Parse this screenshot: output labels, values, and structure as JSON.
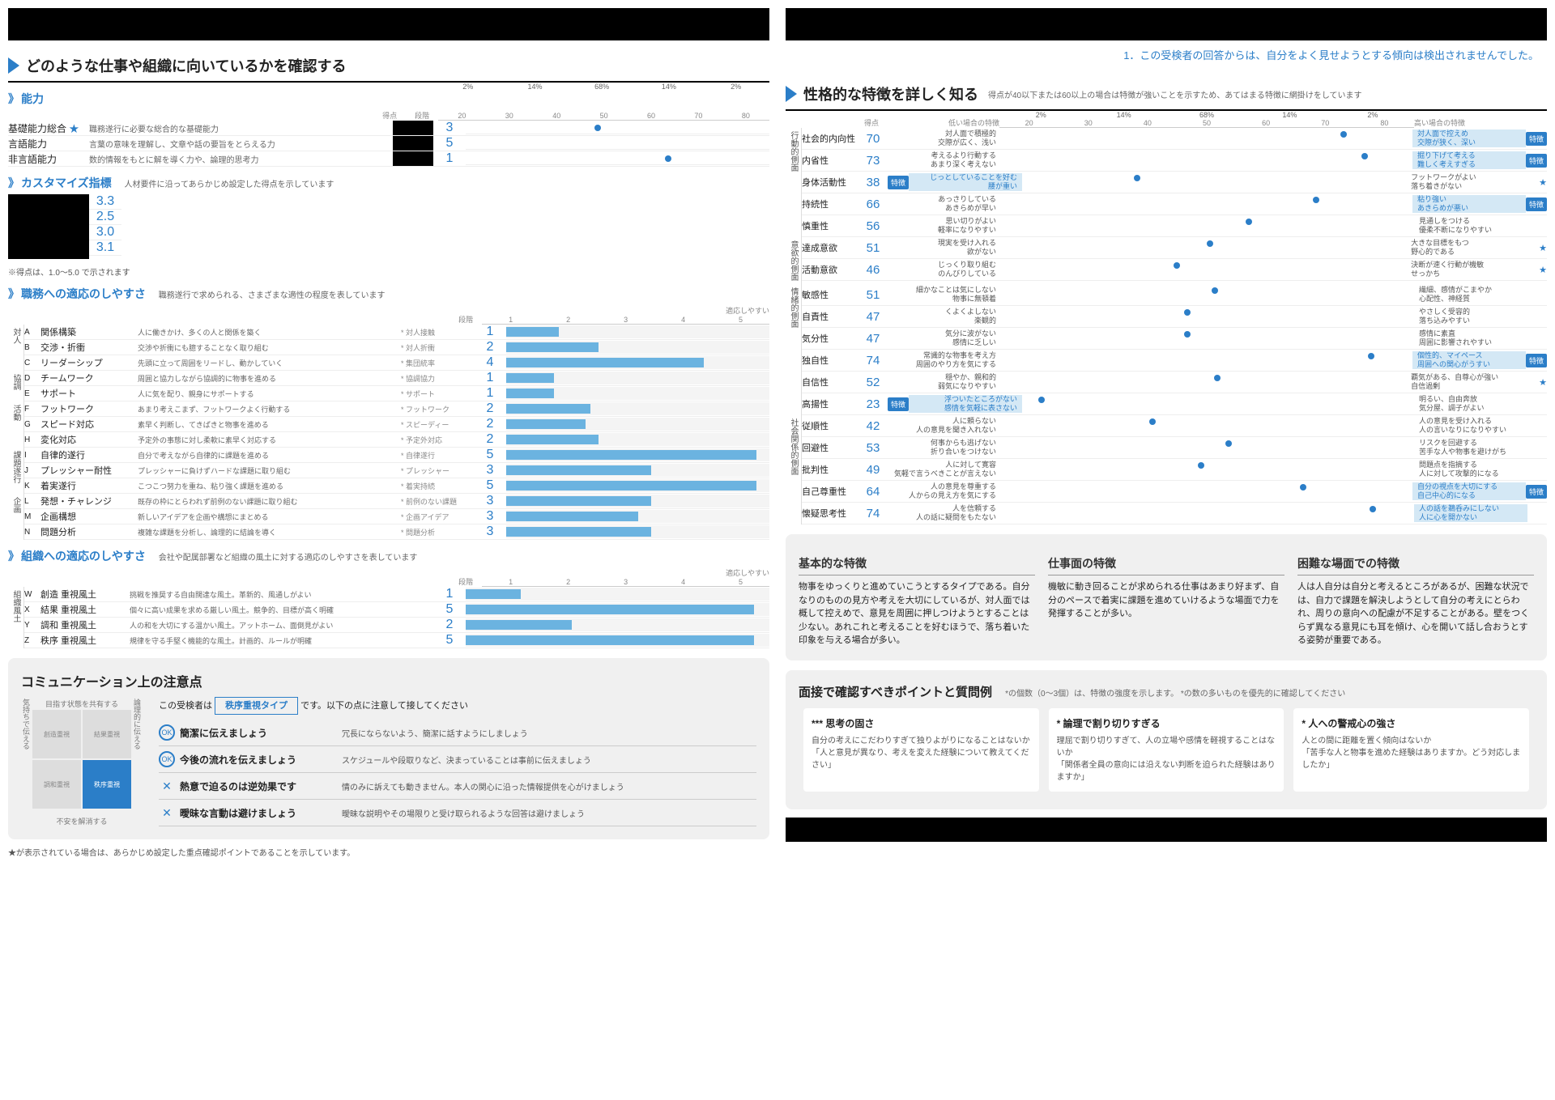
{
  "notice": "1．この受検者の回答からは、自分をよく見せようとする傾向は検出されませんでした。",
  "left": {
    "title": "どのような仕事や組織に向いているかを確認する",
    "ability": {
      "header": "能力",
      "score_label": "得点",
      "stage_label": "段階",
      "dist": [
        "2%",
        "14%",
        "68%",
        "14%",
        "2%"
      ],
      "axis": [
        "20",
        "30",
        "40",
        "50",
        "60",
        "70",
        "80"
      ],
      "rows": [
        {
          "name": "基礎能力総合",
          "star": true,
          "desc": "職務遂行に必要な総合的な基礎能力",
          "stage": 3,
          "dot": 46
        },
        {
          "name": "言語能力",
          "desc": "言葉の意味を理解し、文章や話の要旨をとらえる力",
          "stage": 5,
          "dot": null
        },
        {
          "name": "非言語能力",
          "desc": "数的情報をもとに解を導く力や、論理的思考力",
          "stage": 1,
          "dot": 60
        }
      ]
    },
    "customize": {
      "header": "カスタマイズ指標",
      "note": "人材要件に沿ってあらかじめ設定した得点を示しています",
      "scores": [
        "3.3",
        "2.5",
        "3.0",
        "3.1"
      ],
      "footnote": "※得点は、1.0～5.0 で示されます"
    },
    "job_adapt": {
      "header": "職務への適応のしやすさ",
      "note": "職務遂行で求められる、さまざまな適性の程度を表しています",
      "stage_label": "段階",
      "legend": "適応しやすい",
      "axis": [
        "1",
        "2",
        "3",
        "4",
        "5"
      ],
      "groups": [
        {
          "label": "対人",
          "rows": [
            {
              "code": "A",
              "name": "関係構築",
              "desc": "人に働きかけ、多くの人と関係を築く",
              "tag": "* 対人接触",
              "stage": 1,
              "bar": 20
            },
            {
              "code": "B",
              "name": "交渉・折衝",
              "desc": "交渉や折衝にも臆することなく取り組む",
              "tag": "* 対人折衝",
              "stage": 2,
              "bar": 35
            },
            {
              "code": "C",
              "name": "リーダーシップ",
              "desc": "先頭に立って周囲をリードし、動かしていく",
              "tag": "* 集団統率",
              "stage": 4,
              "bar": 75
            }
          ]
        },
        {
          "label": "協調",
          "rows": [
            {
              "code": "D",
              "name": "チームワーク",
              "desc": "周囲と協力しながら協調的に物事を進める",
              "tag": "* 協調協力",
              "stage": 1,
              "bar": 18
            },
            {
              "code": "E",
              "name": "サポート",
              "desc": "人に気を配り、親身にサポートする",
              "tag": "* サポート",
              "stage": 1,
              "bar": 18
            }
          ]
        },
        {
          "label": "活動",
          "rows": [
            {
              "code": "F",
              "name": "フットワーク",
              "desc": "あまり考えこまず、フットワークよく行動する",
              "tag": "* フットワーク",
              "stage": 2,
              "bar": 32
            },
            {
              "code": "G",
              "name": "スピード対応",
              "desc": "素早く判断し、てきぱきと物事を進める",
              "tag": "* スピーディー",
              "stage": 2,
              "bar": 30
            },
            {
              "code": "H",
              "name": "変化対応",
              "desc": "予定外の事態に対し柔軟に素早く対応する",
              "tag": "* 予定外対応",
              "stage": 2,
              "bar": 35
            }
          ]
        },
        {
          "label": "課題遂行",
          "rows": [
            {
              "code": "I",
              "name": "自律的遂行",
              "desc": "自分で考えながら自律的に課題を進める",
              "tag": "* 自律遂行",
              "stage": 5,
              "bar": 95
            },
            {
              "code": "J",
              "name": "プレッシャー耐性",
              "desc": "プレッシャーに負けずハードな課題に取り組む",
              "tag": "* プレッシャー",
              "stage": 3,
              "bar": 55
            },
            {
              "code": "K",
              "name": "着実遂行",
              "desc": "こつこつ努力を重ね、粘り強く課題を進める",
              "tag": "* 着実持続",
              "stage": 5,
              "bar": 95
            }
          ]
        },
        {
          "label": "企画",
          "rows": [
            {
              "code": "L",
              "name": "発想・チャレンジ",
              "desc": "既存の枠にとらわれず前例のない課題に取り組む",
              "tag": "* 前例のない課題",
              "stage": 3,
              "bar": 55
            },
            {
              "code": "M",
              "name": "企画構想",
              "desc": "新しいアイデアを企画や構想にまとめる",
              "tag": "* 企画アイデア",
              "stage": 3,
              "bar": 50
            },
            {
              "code": "N",
              "name": "問題分析",
              "desc": "複雑な課題を分析し、論理的に結論を導く",
              "tag": "* 問題分析",
              "stage": 3,
              "bar": 55
            }
          ]
        }
      ]
    },
    "org_adapt": {
      "header": "組織への適応のしやすさ",
      "note": "会社や配属部署など組織の風土に対する適応のしやすさを表しています",
      "stage_label": "段階",
      "legend": "適応しやすい",
      "axis": [
        "1",
        "2",
        "3",
        "4",
        "5"
      ],
      "group_label": "組織風土",
      "rows": [
        {
          "code": "W",
          "name": "創造 重視風土",
          "desc": "挑戦を推奨する自由闊達な風土。革新的、風通しがよい",
          "stage": 1,
          "bar": 18
        },
        {
          "code": "X",
          "name": "結果 重視風土",
          "desc": "個々に高い成果を求める厳しい風土。競争的、目標が高く明確",
          "stage": 5,
          "bar": 95
        },
        {
          "code": "Y",
          "name": "調和 重視風土",
          "desc": "人の和を大切にする温かい風土。アットホーム、面倒見がよい",
          "stage": 2,
          "bar": 35
        },
        {
          "code": "Z",
          "name": "秩序 重視風土",
          "desc": "規律を守る手堅く機能的な風土。計画的、ルールが明確",
          "stage": 5,
          "bar": 95
        }
      ]
    },
    "comm": {
      "title": "コミュニケーション上の注意点",
      "intro_pre": "この受検者は",
      "type": "秩序重視タイプ",
      "intro_post": "です。以下の点に注意して接してください",
      "quad_axes": {
        "top": "目指す状態を共有する",
        "bottom": "不安を解消する",
        "left": "気持ちで伝える",
        "right": "論理的に伝える"
      },
      "quad": [
        "創造重視",
        "結果重視",
        "調和重視",
        "秩序重視"
      ],
      "tips": [
        {
          "ok": true,
          "label": "簡潔に伝えましょう",
          "desc": "冗長にならないよう、簡潔に話すようにしましょう"
        },
        {
          "ok": true,
          "label": "今後の流れを伝えましょう",
          "desc": "スケジュールや段取りなど、決まっていることは事前に伝えましょう"
        },
        {
          "ok": false,
          "label": "熱意で迫るのは逆効果です",
          "desc": "情のみに訴えても動きません。本人の関心に沿った情報提供を心がけましょう"
        },
        {
          "ok": false,
          "label": "曖昧な言動は避けましょう",
          "desc": "曖昧な説明やその場限りと受け取られるような回答は避けましょう"
        }
      ]
    },
    "footnote": "★が表示されている場合は、あらかじめ設定した重点確認ポイントであることを示しています。"
  },
  "right": {
    "title": "性格的な特徴を詳しく知る",
    "title_note": "得点が40以下または60以上の場合は特徴が強いことを示すため、あてはまる特徴に網掛けをしています",
    "score_label": "得点",
    "low_label": "低い場合の特徴",
    "high_label": "高い場合の特徴",
    "dist": [
      "2%",
      "14%",
      "68%",
      "14%",
      "2%"
    ],
    "axis": [
      "20",
      "30",
      "40",
      "50",
      "60",
      "70",
      "80"
    ],
    "groups": [
      {
        "label": "行動的側面",
        "rows": [
          {
            "name": "社会的内向性",
            "score": 70,
            "low": "対人面で積極的\n交際が広く、浅い",
            "high": "対人面で控えめ\n交際が狭く、深い",
            "hl": "high",
            "badge_r": true,
            "star": false
          },
          {
            "name": "内省性",
            "score": 73,
            "low": "考えるより行動する\nあまり深く考えない",
            "high": "掘り下げて考える\n難しく考えすぎる",
            "hl": "high",
            "badge_r": true
          },
          {
            "name": "身体活動性",
            "score": 38,
            "low": "じっとしていることを好む\n腰が重い",
            "high": "フットワークがよい\n落ち着きがない",
            "hl": "low",
            "badge_l": true,
            "star": true
          },
          {
            "name": "持続性",
            "score": 66,
            "low": "あっさりしている\nあきらめが早い",
            "high": "粘り強い\nあきらめが悪い",
            "hl": "high",
            "badge_r": true
          },
          {
            "name": "慎重性",
            "score": 56,
            "low": "思い切りがよい\n軽率になりやすい",
            "high": "見通しをつける\n優柔不断になりやすい"
          }
        ]
      },
      {
        "label": "意欲的側面",
        "rows": [
          {
            "name": "達成意欲",
            "score": 51,
            "low": "現実を受け入れる\n欲がない",
            "high": "大きな目標をもつ\n野心的である",
            "star": true
          },
          {
            "name": "活動意欲",
            "score": 46,
            "low": "じっくり取り組む\nのんびりしている",
            "high": "決断が速く行動が機敏\nせっかち",
            "star": true
          }
        ]
      },
      {
        "label": "情緒的側面",
        "rows": [
          {
            "name": "敏感性",
            "score": 51,
            "low": "細かなことは気にしない\n物事に無頓着",
            "high": "繊細、感情がこまやか\n心配性、神経質"
          },
          {
            "name": "自責性",
            "score": 47,
            "low": "くよくよしない\n楽観的",
            "high": "やさしく受容的\n落ち込みやすい"
          },
          {
            "name": "気分性",
            "score": 47,
            "low": "気分に波がない\n感情に乏しい",
            "high": "感情に素直\n周囲に影響されやすい"
          },
          {
            "name": "独自性",
            "score": 74,
            "low": "常識的な物事を考え方\n周囲のやり方を気にする",
            "high": "個性的、マイペース\n周囲への関心がうすい",
            "hl": "high",
            "badge_r": true
          },
          {
            "name": "自信性",
            "score": 52,
            "low": "穏やか、親和的\n弱気になりやすい",
            "high": "覇気がある、自尊心が強い\n自信過剰",
            "star": true
          },
          {
            "name": "高揚性",
            "score": 23,
            "low": "浮ついたところがない\n感情を気軽に表さない",
            "high": "明るい、自由奔放\n気分屋、調子がよい",
            "hl": "low",
            "badge_l": true
          }
        ]
      },
      {
        "label": "社会関係的側面",
        "rows": [
          {
            "name": "従順性",
            "score": 42,
            "low": "人に頼らない\n人の意見を聞き入れない",
            "high": "人の意見を受け入れる\n人の言いなりになりやすい"
          },
          {
            "name": "回避性",
            "score": 53,
            "low": "何事からも逃げない\n折り合いをつけない",
            "high": "リスクを回避する\n苦手な人や物事を避けがち"
          },
          {
            "name": "批判性",
            "score": 49,
            "low": "人に対して寛容\n気軽で言うべきことが言えない",
            "high": "問題点を指摘する\n人に対して攻撃的になる"
          },
          {
            "name": "自己尊重性",
            "score": 64,
            "low": "人の意見を尊重する\n人からの見え方を気にする",
            "high": "自分の視点を大切にする\n自己中心的になる",
            "hl": "high",
            "badge_r": true
          },
          {
            "name": "懐疑思考性",
            "score": 74,
            "low": "人を信頼する\n人の話に疑問をもたない",
            "high": "人の話を鵜呑みにしない\n人に心を開かない",
            "hl": "high"
          }
        ]
      }
    ],
    "features": {
      "cols": [
        {
          "title": "基本的な特徴",
          "text": "物事をゆっくりと進めていこうとするタイプである。自分なりのものの見方や考えを大切にしているが、対人面では概して控えめで、意見を周囲に押しつけようとすることは少ない。あれこれと考えることを好むほうで、落ち着いた印象を与える場合が多い。"
        },
        {
          "title": "仕事面の特徴",
          "text": "機敏に動き回ることが求められる仕事はあまり好まず、自分のペースで着実に課題を進めていけるような場面で力を発揮することが多い。"
        },
        {
          "title": "困難な場面での特徴",
          "text": "人は人自分は自分と考えるところがあるが、困難な状況では、自力で課題を解決しようとして自分の考えにとらわれ、周りの意向への配慮が不足することがある。壁をつくらず異なる意見にも耳を傾け、心を開いて話し合おうとする姿勢が重要である。"
        }
      ]
    },
    "interview": {
      "title": "面接で確認すべきポイントと質問例",
      "note": "*の個数（0～3個）は、特徴の強度を示します。 *の数の多いものを優先的に確認してください",
      "boxes": [
        {
          "stars": "***",
          "title": "思考の固さ",
          "line1": "自分の考えにこだわりすぎて独りよがりになることはないか",
          "line2": "「人と意見が異なり、考えを変えた経験について教えてください」"
        },
        {
          "stars": "*",
          "title": "論理で割り切りすぎる",
          "line1": "理屈で割り切りすぎて、人の立場や感情を軽視することはないか",
          "line2": "「関係者全員の意向には沿えない判断を迫られた経験はありますか」"
        },
        {
          "stars": "*",
          "title": "人への警戒心の強さ",
          "line1": "人との間に距離を置く傾向はないか",
          "line2": "「苦手な人と物事を進めた経験はありますか。どう対応しましたか」"
        }
      ]
    }
  }
}
